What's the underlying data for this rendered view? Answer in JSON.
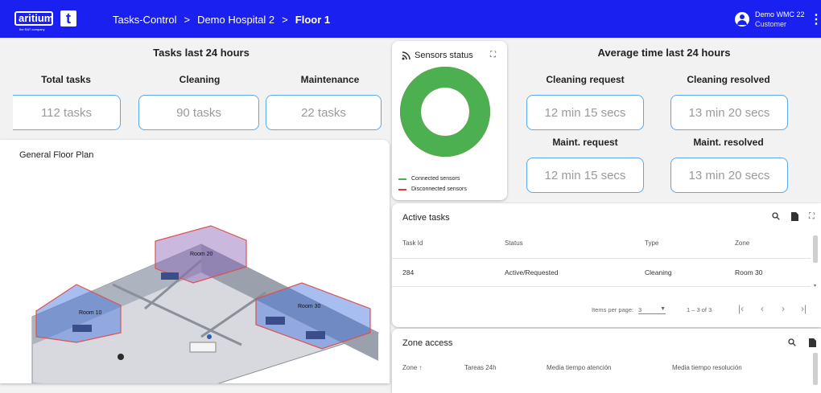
{
  "header": {
    "logo_text": "aritium",
    "logo_subtext": "the RAT company",
    "logo_t": "t",
    "breadcrumb": [
      "Tasks-Control",
      ">",
      "Demo Hospital 2",
      ">",
      "Floor 1"
    ],
    "user_name": "Demo WMC 22",
    "user_role": "Customer",
    "menu_icon": "kebab-icon"
  },
  "tasks24": {
    "title": "Tasks last 24 hours",
    "total_label": "Total tasks",
    "total_value": "112 tasks",
    "cleaning_label": "Cleaning",
    "cleaning_value": "90 tasks",
    "maintenance_label": "Maintenance",
    "maintenance_value": "22 tasks"
  },
  "sensors": {
    "title": "Sensors status",
    "connected_label": "Connected sensors",
    "disconnected_label": "Disconnected sensors",
    "connected_color": "#4caf50",
    "disconnected_color": "#e53935",
    "connected_fraction": 1.0
  },
  "avg_time": {
    "title": "Average time last 24 hours",
    "cleaning_request_label": "Cleaning request",
    "cleaning_request_value": "12 min 15 secs",
    "cleaning_resolved_label": "Cleaning resolved",
    "cleaning_resolved_value": "13 min 20 secs",
    "maint_request_label": "Maint. request",
    "maint_request_value": "12 min 15 secs",
    "maint_resolved_label": "Maint. resolved",
    "maint_resolved_value": "13 min 20 secs"
  },
  "floor_plan": {
    "title": "General Floor Plan",
    "rooms": [
      "Room 20",
      "Room 10",
      "Room 30"
    ]
  },
  "active_tasks": {
    "title": "Active tasks",
    "columns": [
      "Task Id",
      "Status",
      "Type",
      "Zone"
    ],
    "rows": [
      [
        "284",
        "Active/Requested",
        "Cleaning",
        "Room 30"
      ]
    ],
    "items_per_page_label": "Items per page:",
    "items_per_page_value": "3",
    "range": "1 – 3 of 3"
  },
  "zone_access": {
    "title": "Zone access",
    "columns": [
      "Zone",
      "Tareas 24h",
      "Media tiempo atención",
      "Media tiempo resolución"
    ]
  },
  "colors": {
    "topbar": "#1a20f0",
    "accent_border": "#5aa8f0"
  }
}
